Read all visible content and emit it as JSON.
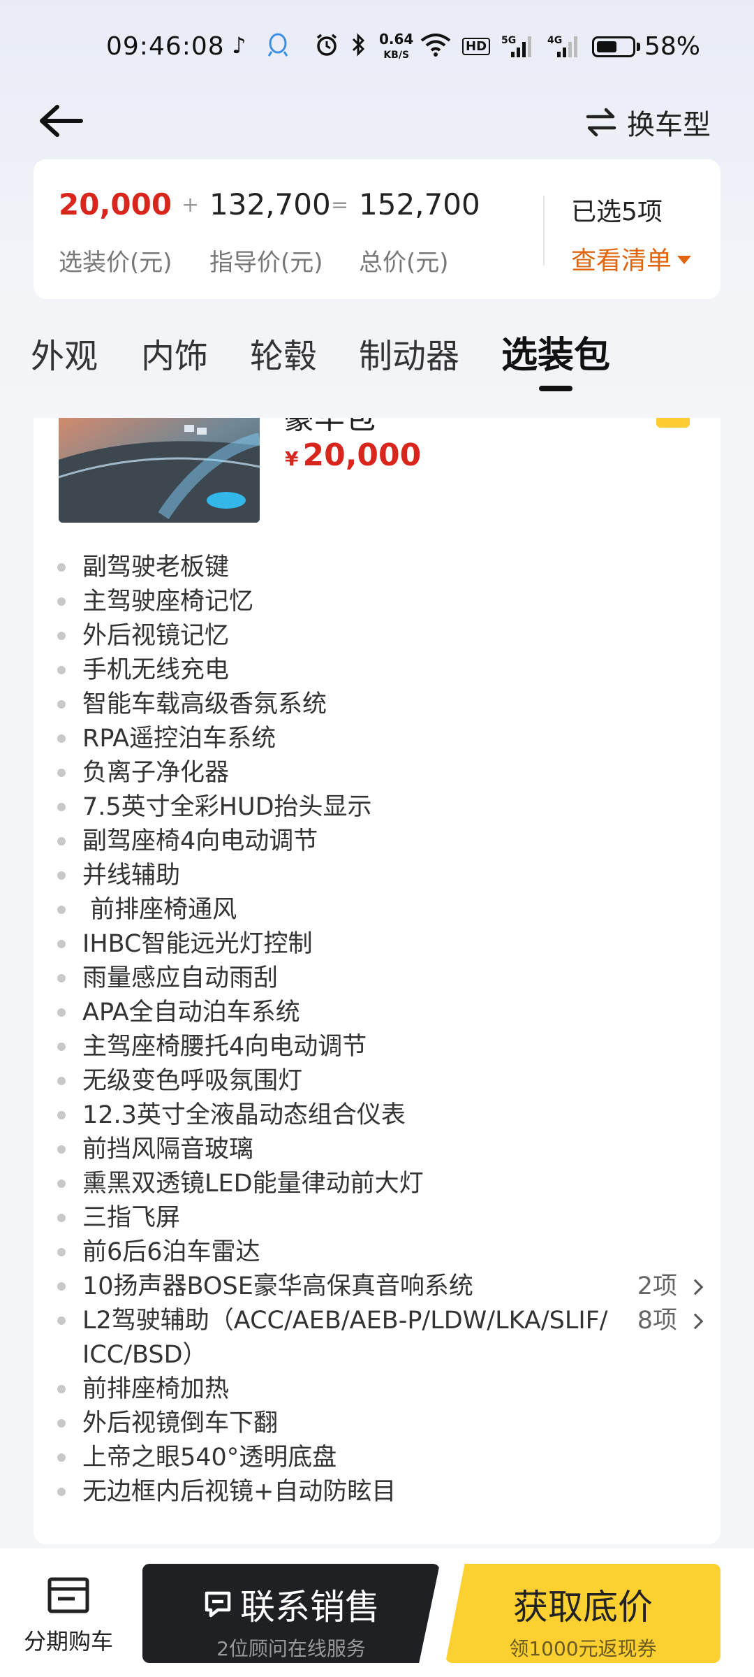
{
  "status_bar": {
    "time": "09:46:08",
    "net_speed_value": "0.64",
    "net_speed_unit": "KB/S",
    "signal_1": "5G",
    "signal_2": "4G",
    "hd_label": "HD",
    "battery": "58%"
  },
  "nav": {
    "switch_model_label": "换车型"
  },
  "price_summary": {
    "option_price": "20,000",
    "plus": "+",
    "guide_price": "132,700",
    "equals": "=",
    "total_price": "152,700",
    "option_price_label": "选装价(元)",
    "guide_price_label": "指导价(元)",
    "total_price_label": "总价(元)",
    "selected_count": "已选5项",
    "view_list_label": "查看清单"
  },
  "tabs": [
    {
      "label": "外观"
    },
    {
      "label": "内饰"
    },
    {
      "label": "轮毂"
    },
    {
      "label": "制动器"
    },
    {
      "label": "选装包"
    }
  ],
  "package": {
    "title_partial": "豪华包",
    "price_symbol": "¥",
    "price": "20,000",
    "features": [
      {
        "text": "副驾驶老板键"
      },
      {
        "text": "主驾驶座椅记忆"
      },
      {
        "text": "外后视镜记忆"
      },
      {
        "text": "手机无线充电"
      },
      {
        "text": "智能车载高级香氛系统"
      },
      {
        "text": "RPA遥控泊车系统"
      },
      {
        "text": "负离子净化器"
      },
      {
        "text": "7.5英寸全彩HUD抬头显示"
      },
      {
        "text": "副驾座椅4向电动调节"
      },
      {
        "text": "并线辅助"
      },
      {
        "text": " 前排座椅通风"
      },
      {
        "text": "IHBC智能远光灯控制"
      },
      {
        "text": "雨量感应自动雨刮"
      },
      {
        "text": "APA全自动泊车系统"
      },
      {
        "text": "主驾座椅腰托4向电动调节"
      },
      {
        "text": "无级变色呼吸氛围灯"
      },
      {
        "text": "12.3英寸全液晶动态组合仪表"
      },
      {
        "text": "前挡风隔音玻璃"
      },
      {
        "text": "熏黑双透镜LED能量律动前大灯"
      },
      {
        "text": "三指飞屏"
      },
      {
        "text": "前6后6泊车雷达"
      },
      {
        "text": "10扬声器BOSE豪华高保真音响系统",
        "count": "2项"
      },
      {
        "text": "L2驾驶辅助（ACC/AEB/AEB-P/LDW/LKA/SLIF/ICC/BSD）",
        "count": "8项"
      },
      {
        "text": "前排座椅加热"
      },
      {
        "text": "外后视镜倒车下翻"
      },
      {
        "text": "上帝之眼540°透明底盘"
      },
      {
        "text": "无边框内后视镜+自动防眩目"
      }
    ]
  },
  "bottom_bar": {
    "installment_label": "分期购车",
    "contact_title": "联系销售",
    "contact_sub": "2位顾问在线服务",
    "price_title": "获取底价",
    "price_sub": "领1000元返现券"
  },
  "colors": {
    "accent_red": "#d9261c",
    "accent_orange": "#e0650f",
    "cta_yellow": "#fdd032",
    "cta_dark": "#1f2024"
  }
}
